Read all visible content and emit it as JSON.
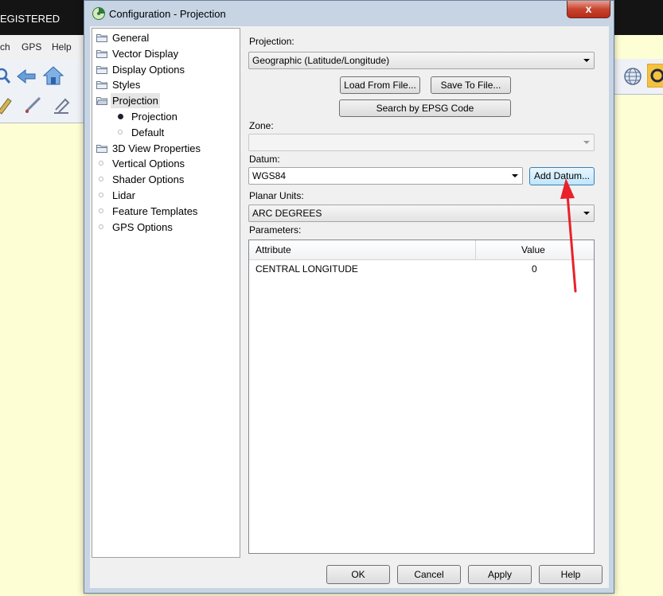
{
  "background_app": {
    "title_fragment": "EGISTERED",
    "menu": [
      "ch",
      "GPS",
      "Help"
    ]
  },
  "dialog": {
    "title": "Configuration - Projection",
    "close_label": "x",
    "tree": [
      {
        "label": "General",
        "type": "folder"
      },
      {
        "label": "Vector Display",
        "type": "folder"
      },
      {
        "label": "Display Options",
        "type": "folder"
      },
      {
        "label": "Styles",
        "type": "folder"
      },
      {
        "label": "Projection",
        "type": "folder-open",
        "selected": true
      },
      {
        "label": "Projection",
        "type": "child-active"
      },
      {
        "label": "Default",
        "type": "child"
      },
      {
        "label": "3D View Properties",
        "type": "folder"
      },
      {
        "label": "Vertical Options",
        "type": "leaf"
      },
      {
        "label": "Shader Options",
        "type": "leaf"
      },
      {
        "label": "Lidar",
        "type": "leaf"
      },
      {
        "label": "Feature Templates",
        "type": "leaf"
      },
      {
        "label": "GPS Options",
        "type": "leaf"
      }
    ],
    "projection": {
      "label": "Projection:",
      "value": "Geographic (Latitude/Longitude)",
      "load_button": "Load From File...",
      "save_button": "Save To File...",
      "epsg_button": "Search by EPSG Code"
    },
    "zone": {
      "label": "Zone:",
      "value": ""
    },
    "datum": {
      "label": "Datum:",
      "value": "WGS84",
      "add_button": "Add Datum..."
    },
    "planar_units": {
      "label": "Planar Units:",
      "value": "ARC DEGREES"
    },
    "parameters": {
      "label": "Parameters:",
      "columns": [
        "Attribute",
        "Value"
      ],
      "rows": [
        {
          "attribute": "CENTRAL LONGITUDE",
          "value": "0"
        }
      ]
    },
    "buttons": {
      "ok": "OK",
      "cancel": "Cancel",
      "apply": "Apply",
      "help": "Help"
    }
  },
  "annotation_color": "#e8212b"
}
